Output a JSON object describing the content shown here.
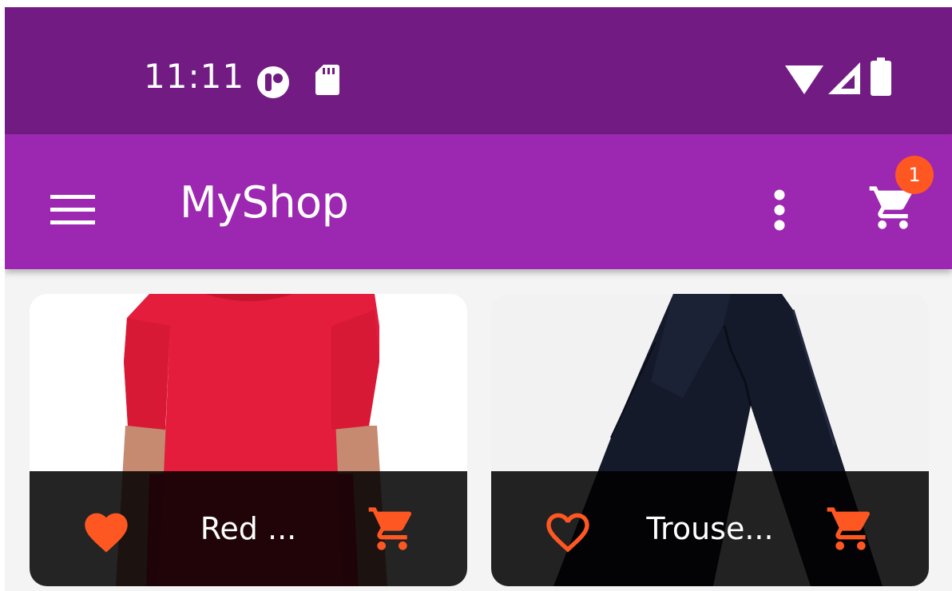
{
  "status_bar": {
    "time": "11:11",
    "background": "#721c83",
    "left_icons": [
      "app-notification-icon",
      "sd-card-icon"
    ],
    "right_icons": [
      "wifi-icon",
      "cell-signal-icon",
      "battery-icon"
    ]
  },
  "app_bar": {
    "title": "MyShop",
    "background": "#9c27b0",
    "menu_icon": "hamburger-menu-icon",
    "overflow_icon": "more-vert-icon",
    "cart_icon": "shopping-cart-icon",
    "cart_badge_count": "1",
    "badge_color": "#ff5722"
  },
  "products": [
    {
      "title": "Red ...",
      "favorite": true,
      "image": "red-t-shirt-photo",
      "favorite_icon": "heart-filled-icon",
      "cart_icon": "add-shopping-cart-icon"
    },
    {
      "title": "Trouse...",
      "favorite": false,
      "image": "black-trousers-photo",
      "favorite_icon": "heart-outline-icon",
      "cart_icon": "add-shopping-cart-icon"
    }
  ],
  "colors": {
    "accent": "#ff5722",
    "footer_overlay": "#000000",
    "screen_background": "#f4f4f4"
  }
}
